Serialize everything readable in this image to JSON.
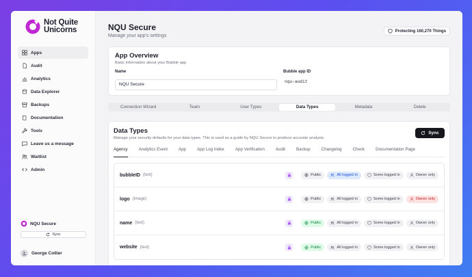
{
  "brand": {
    "line1": "Not Quite",
    "line2": "Unicorns",
    "accent": "#c026d3"
  },
  "nav": [
    {
      "label": "Apps",
      "icon": "grid-icon",
      "active": true
    },
    {
      "label": "Audit",
      "icon": "file-icon"
    },
    {
      "label": "Analytics",
      "icon": "chart-icon"
    },
    {
      "label": "Data Explorer",
      "icon": "database-icon"
    },
    {
      "label": "Backups",
      "icon": "archive-icon"
    },
    {
      "label": "Documentation",
      "icon": "book-icon"
    },
    {
      "label": "Tools",
      "icon": "wrench-icon"
    },
    {
      "label": "Leave us a message",
      "icon": "message-icon"
    },
    {
      "label": "Waitlist",
      "icon": "users-icon"
    },
    {
      "label": "Admin",
      "icon": "code-icon"
    }
  ],
  "sidebar_app": {
    "name": "NQU Secure",
    "sync_label": "Sync"
  },
  "user": {
    "name": "George Collier"
  },
  "header": {
    "title": "NQU Secure",
    "subtitle": "Manage your app's settings",
    "badge": "Protecting 160,270 Things"
  },
  "overview": {
    "title": "App Overview",
    "subtitle": "Basic information about your Bubble app",
    "name_label": "Name",
    "name_value": "NQU Secure",
    "id_label": "Bubble app ID",
    "id_value": "nqu-audit"
  },
  "tabs": [
    "Connection Wizard",
    "Team",
    "User Types",
    "Data Types",
    "Metadata",
    "Delete"
  ],
  "active_tab": "Data Types",
  "data_types": {
    "title": "Data Types",
    "subtitle": "Manage your security defaults for your data types. This is used as a guide by NQU Secure to produce accurate analysis.",
    "sync_label": "Sync",
    "subtabs": [
      "Agency",
      "Analytics Event",
      "App",
      "App Log Index",
      "App Verification",
      "Audit",
      "Backup",
      "Changelog",
      "Check",
      "Documentation Page"
    ],
    "active_subtab": "Agency",
    "options": [
      "Public",
      "All logged in",
      "Some logged in",
      "Owner only"
    ],
    "rows": [
      {
        "name": "bubbleID",
        "type": "(text)",
        "selected": "All logged in"
      },
      {
        "name": "logo",
        "type": "(image)",
        "selected": "Owner only"
      },
      {
        "name": "name",
        "type": "(text)",
        "selected": "Public"
      },
      {
        "name": "website",
        "type": "(text)",
        "selected": "Public"
      }
    ]
  }
}
